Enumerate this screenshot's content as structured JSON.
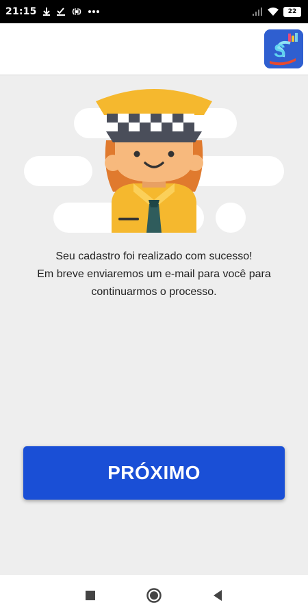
{
  "status_bar": {
    "time": "21:15",
    "notification_icons": [
      "download-icon",
      "check-download-icon",
      "broadcast-icon",
      "more-dots-icon"
    ],
    "battery_level": "22"
  },
  "app_bar": {
    "logo_letter": "S"
  },
  "message": {
    "line1": "Seu cadastro foi realizado com sucesso!",
    "line2": "Em breve enviaremos um e-mail para você para",
    "line3": "continuarmos o processo."
  },
  "button": {
    "label": "PRÓXIMO"
  },
  "colors": {
    "primary": "#1a4fd6",
    "background": "#eeeeee",
    "cap": "#f5b82e",
    "skin": "#f7b97d",
    "hair": "#e07a2e"
  },
  "nav_bar": {
    "icons": [
      "recent-apps-icon",
      "home-icon",
      "back-icon"
    ]
  }
}
